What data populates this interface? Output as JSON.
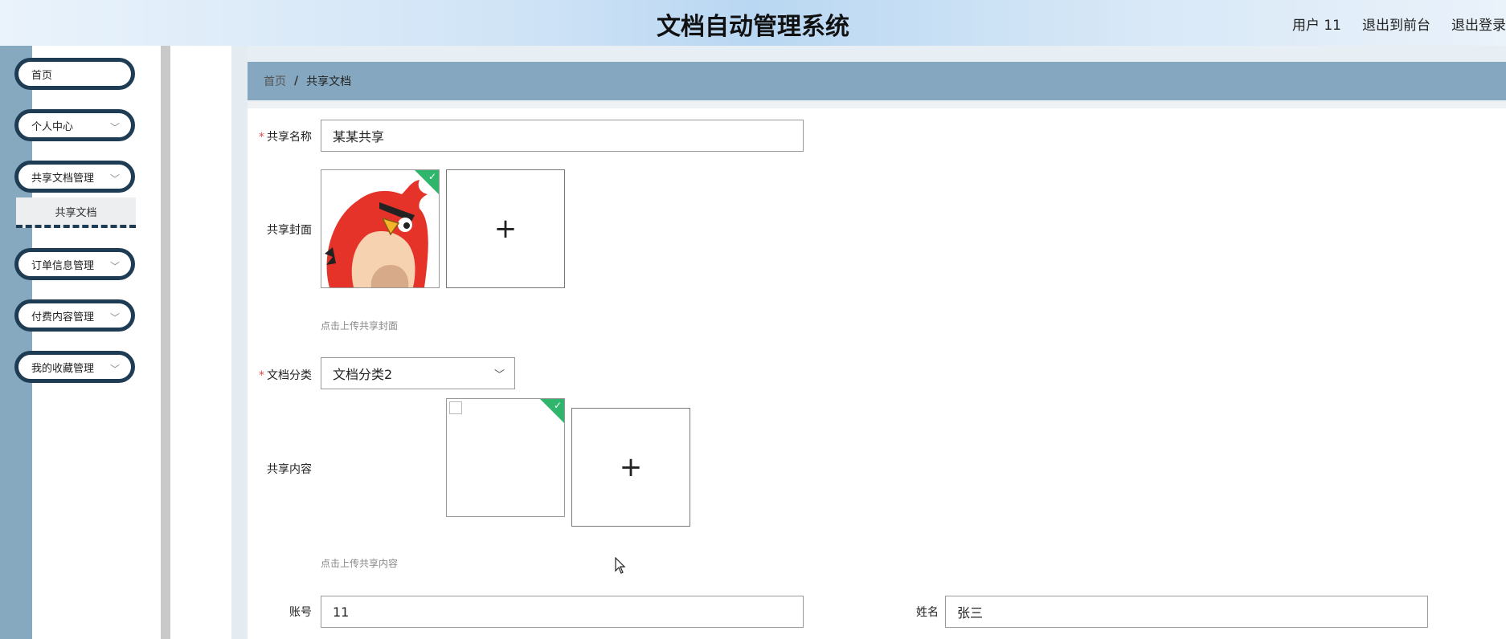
{
  "header": {
    "title": "文档自动管理系统",
    "user": "用户 11",
    "back_front": "退出到前台",
    "logout": "退出登录"
  },
  "sidebar": {
    "items": [
      {
        "label": "首页"
      },
      {
        "label": "个人中心"
      },
      {
        "label": "共享文档管理"
      },
      {
        "label": "订单信息管理"
      },
      {
        "label": "付费内容管理"
      },
      {
        "label": "我的收藏管理"
      }
    ],
    "submenu": {
      "label": "共享文档"
    }
  },
  "breadcrumb": {
    "home": "首页",
    "sep": "/",
    "current": "共享文档"
  },
  "form": {
    "name_label": "共享名称",
    "name_value": "某某共享",
    "cover_label": "共享封面",
    "cover_hint": "点击上传共享封面",
    "category_label": "文档分类",
    "category_value": "文档分类2",
    "content_label": "共享内容",
    "content_hint": "点击上传共享内容",
    "account_label": "账号",
    "account_value": "11",
    "realname_label": "姓名",
    "realname_value": "张三",
    "plus": "+",
    "required_mark": "*"
  },
  "colors": {
    "accent": "#1f3c55",
    "breadcrumb_bg": "#85a8c0",
    "check": "#2fb66c"
  }
}
